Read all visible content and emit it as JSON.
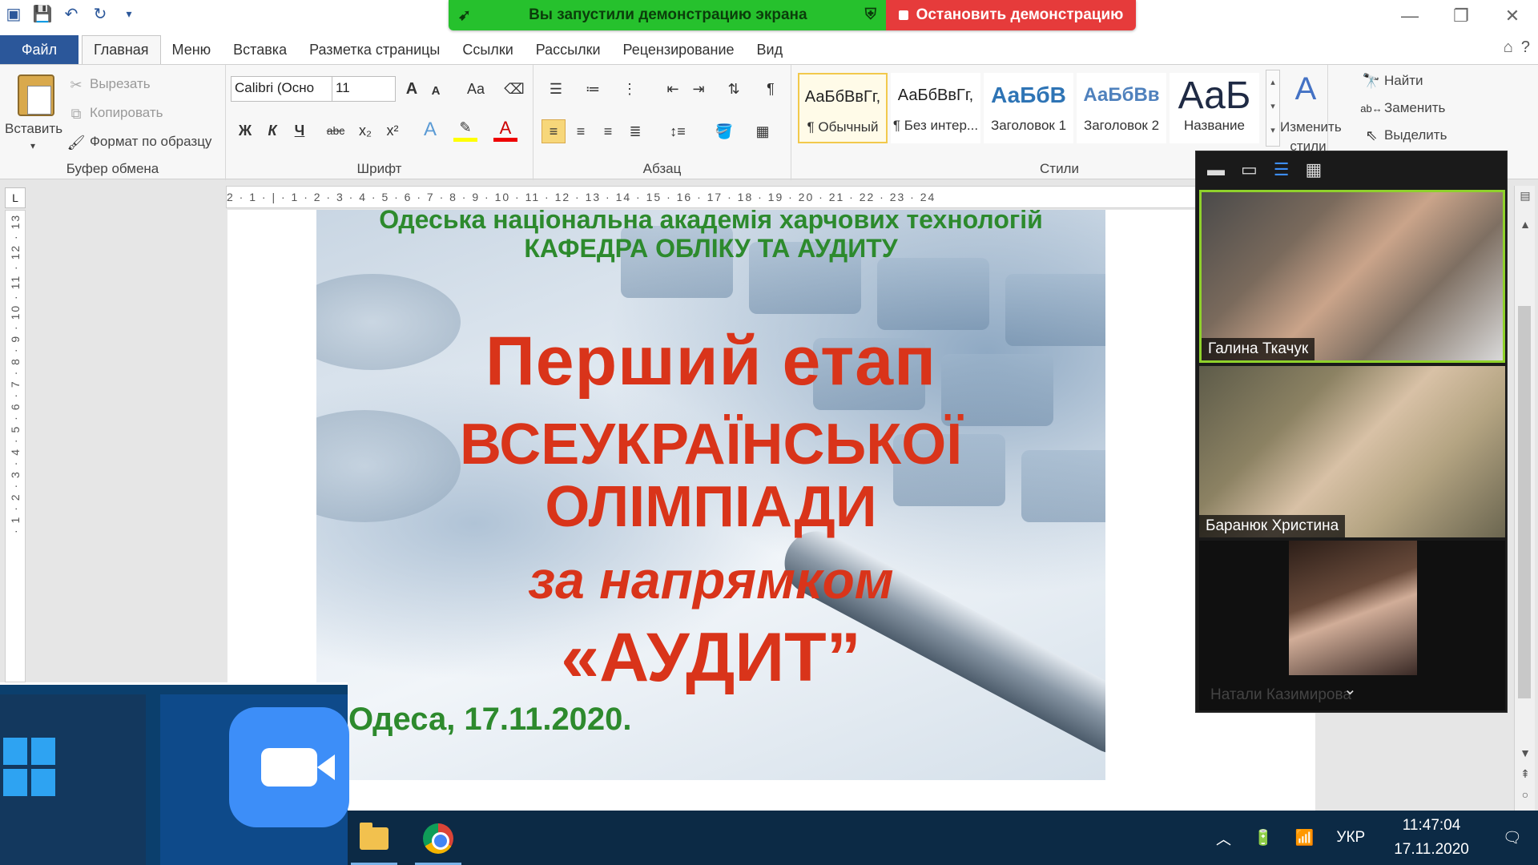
{
  "share_banner": {
    "message": "Вы запустили демонстрацию экрана",
    "stop_label": "Остановить демонстрацию"
  },
  "tabs": [
    "Файл",
    "Главная",
    "Меню",
    "Вставка",
    "Разметка страницы",
    "Ссылки",
    "Рассылки",
    "Рецензирование",
    "Вид"
  ],
  "clipboard": {
    "paste": "Вставить",
    "cut": "Вырезать",
    "copy": "Копировать",
    "format_painter": "Формат по образцу",
    "label": "Буфер обмена"
  },
  "font": {
    "name": "Calibri (Осно",
    "size": "11",
    "label": "Шрифт",
    "bold": "Ж",
    "italic": "К",
    "underline": "Ч",
    "strike": "abc",
    "sub": "x₂",
    "sup": "x²",
    "grow": "A",
    "shrink": "A",
    "case": "Aa"
  },
  "paragraph": {
    "label": "Абзац"
  },
  "styles": {
    "label": "Стили",
    "items": [
      {
        "sample": "АаБбВвГг,",
        "name": "¶ Обычный"
      },
      {
        "sample": "АаБбВвГг,",
        "name": "¶ Без интер..."
      },
      {
        "sample": "АаБбВ",
        "name": "Заголовок 1"
      },
      {
        "sample": "АаБбВв",
        "name": "Заголовок 2"
      },
      {
        "sample": "АаБ",
        "name": "Название"
      }
    ],
    "change": "Изменить стили"
  },
  "editing": {
    "find": "Найти",
    "replace": "Заменить",
    "select": "Выделить"
  },
  "ruler": {
    "h": "2 · 1 · | · 1 · 2 · 3 · 4 · 5 · 6 · 7 · 8 · 9 · 10 · 11 · 12 · 13 · 14 · 15 · 16 · 17 · 18 · 19 · 20 · 21 · 22 · 23 · 24",
    "v": "· 1 · 2 · 3 · 4 · 5 · 6 · 7 · 8 · 9 · 10 · 11 · 12 · 13"
  },
  "slide": {
    "university": "Одеська національна академія харчових технологій",
    "department": "КАФЕДРА ОБЛІКУ ТА АУДИТУ",
    "title1": "Перший етап",
    "title2": "ВСЕУКРАЇНСЬКОЇ",
    "title3": "ОЛІМПІАДИ",
    "title4": "за напрямком",
    "title5": "«АУДИТ”",
    "date": "Одеса, 17.11.2020."
  },
  "zoom": {
    "participants": [
      "Галина Ткачук",
      "Баранюк Христина",
      "Натали Казимирова"
    ]
  },
  "taskbar": {
    "lang": "УКР",
    "time": "11:47:04",
    "date": "17.11.2020"
  },
  "colors": {
    "word_blue": "#2b579a",
    "share_green": "#26c12d",
    "share_red": "#e63b3b",
    "slide_red": "#d9341a",
    "slide_green": "#2d8a2d",
    "zoom_blue": "#3d8ef8"
  }
}
